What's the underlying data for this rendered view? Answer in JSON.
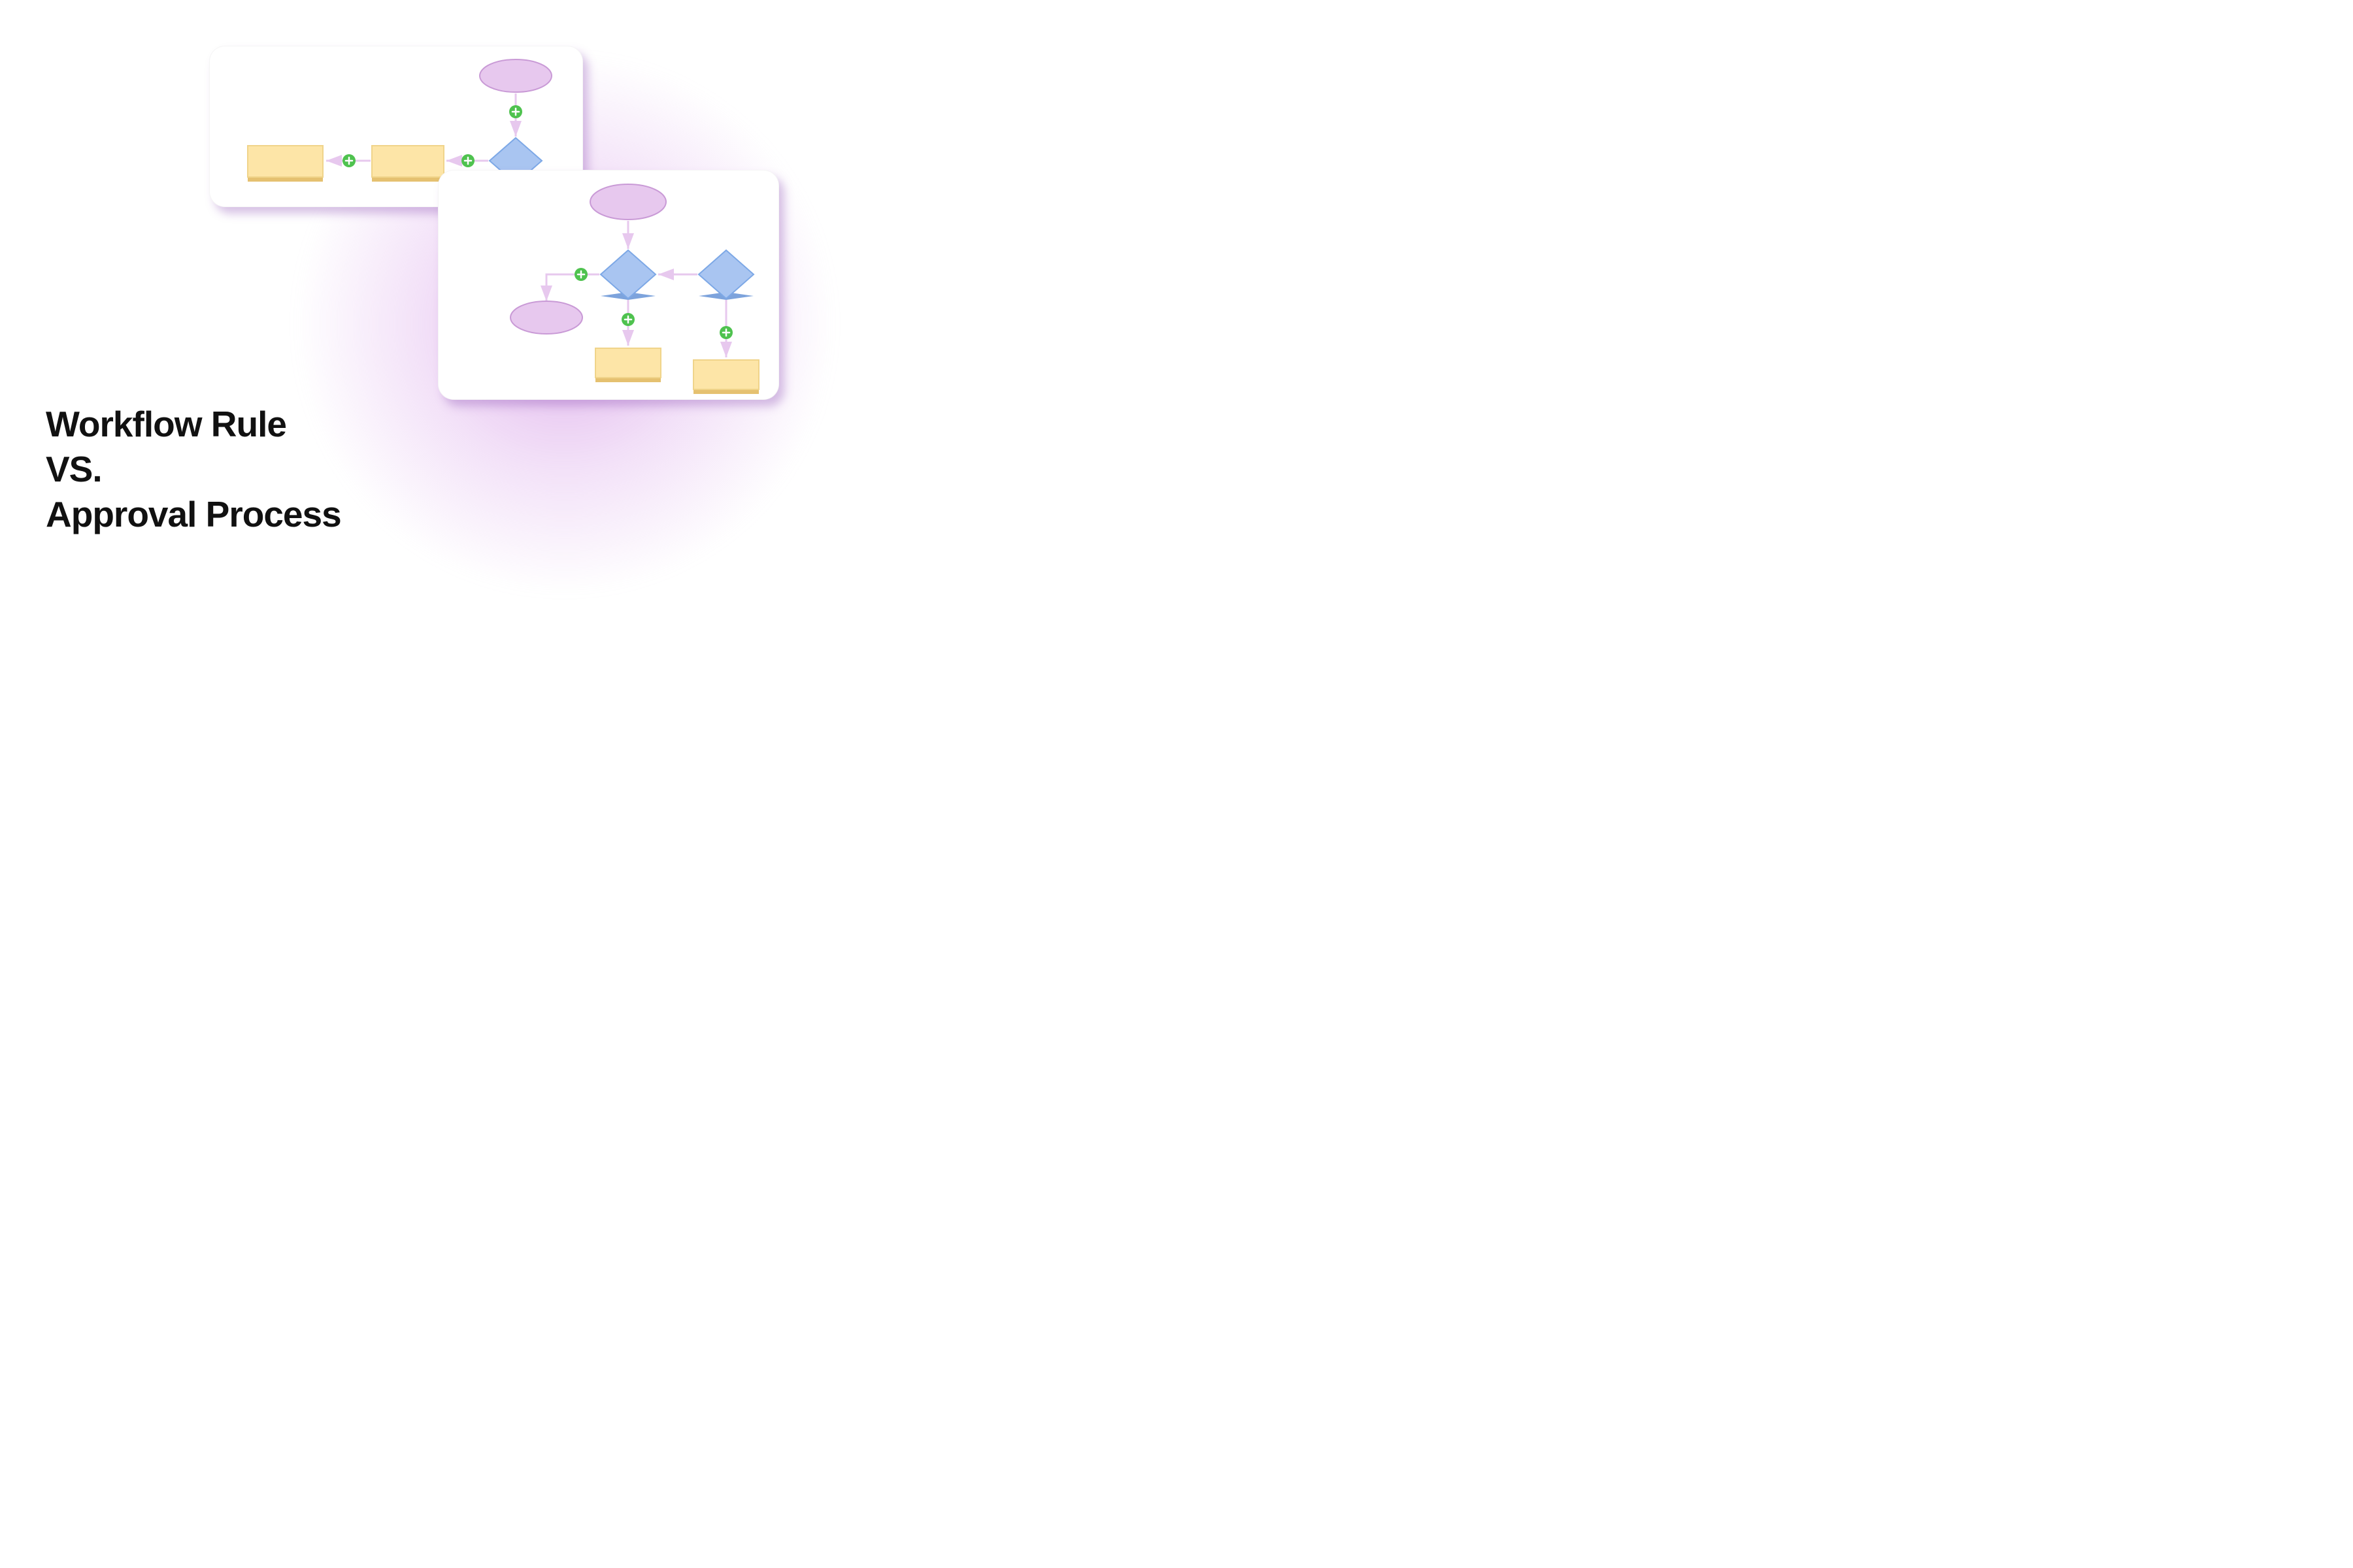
{
  "title_lines": [
    "Workflow Rule",
    "VS.",
    "Approval Process"
  ],
  "colors": {
    "ellipse_fill": "#e7c8ee",
    "ellipse_stroke": "#c99ad6",
    "diamond_fill": "#a9c5f1",
    "diamond_stroke": "#7da8e6",
    "diamond_shadow": "#7da3dc",
    "rect_fill": "#fde5a7",
    "rect_stroke": "#f0d48a",
    "rect_shadow": "#e5c170",
    "plus_bg": "#4fc24f",
    "arrow": "#e7c8ee"
  },
  "diagram_top": {
    "description": "Workflow Rule flow: start ellipse → decision diamond → two sequential process rectangles",
    "nodes": [
      "start-ellipse",
      "decision-diamond",
      "process-rect-1",
      "process-rect-2"
    ],
    "plus_badges": 3
  },
  "diagram_bottom": {
    "description": "Approval Process flow: start ellipse → decision diamond branches to end ellipse and process rect; separate decision diamond → process rect",
    "nodes": [
      "start-ellipse",
      "decision-diamond-1",
      "decision-diamond-2",
      "end-ellipse",
      "process-rect-1",
      "process-rect-2"
    ],
    "plus_badges": 3
  }
}
